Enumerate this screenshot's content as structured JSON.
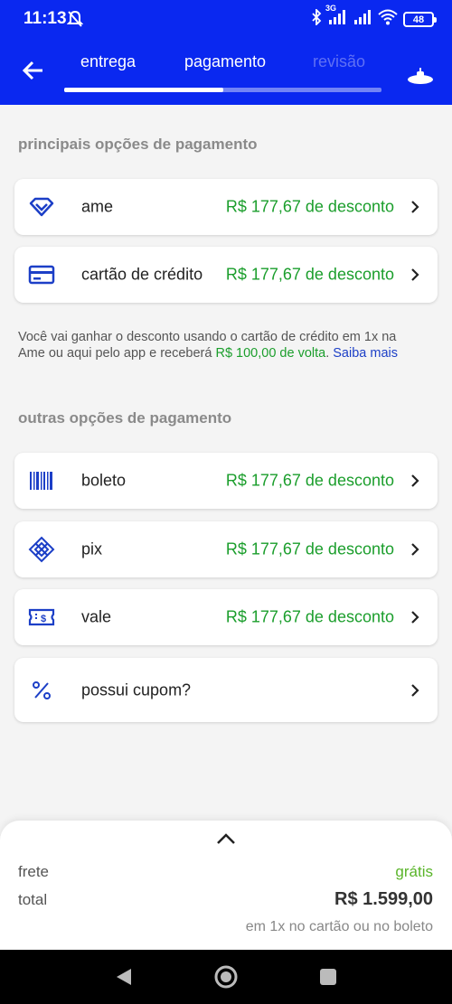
{
  "status_bar": {
    "time": "11:13",
    "network": "3G",
    "battery": "48"
  },
  "header": {
    "tabs": [
      {
        "label": "entrega",
        "state": "done"
      },
      {
        "label": "pagamento",
        "state": "active"
      },
      {
        "label": "revisão",
        "state": "disabled"
      }
    ],
    "progress_fraction": 0.5
  },
  "main_section": {
    "title": "principais opções de pagamento",
    "options": [
      {
        "label": "ame",
        "discount": "R$ 177,67 de desconto",
        "icon": "diamond-icon"
      },
      {
        "label": "cartão de crédito",
        "discount": "R$ 177,67 de desconto",
        "icon": "credit-card-icon"
      }
    ]
  },
  "info": {
    "text_before": "Você vai ganhar o desconto usando o cartão de crédito em 1x na Ame ou aqui pelo app e receberá ",
    "highlight": "R$ 100,00 de volta",
    "text_after": ". ",
    "link": "Saiba mais"
  },
  "other_section": {
    "title": "outras opções de pagamento",
    "options": [
      {
        "label": "boleto",
        "discount": "R$ 177,67 de desconto",
        "icon": "barcode-icon"
      },
      {
        "label": "pix",
        "discount": "R$ 177,67 de desconto",
        "icon": "pix-icon"
      },
      {
        "label": "vale",
        "discount": "R$ 177,67 de desconto",
        "icon": "voucher-icon"
      }
    ],
    "coupon": {
      "label": "possui cupom?",
      "icon": "percent-icon"
    }
  },
  "summary": {
    "frete_label": "frete",
    "frete_value": "grátis",
    "total_label": "total",
    "total_value": "R$ 1.599,00",
    "note": "em 1x no cartão ou no boleto"
  },
  "colors": {
    "brand_blue": "#0a28f0",
    "discount_green": "#1b9e2c",
    "free_green": "#5ab52a",
    "icon_blue": "#1c3fc7"
  }
}
